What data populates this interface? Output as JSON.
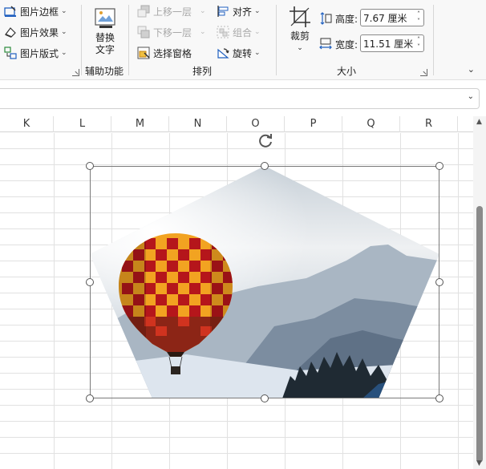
{
  "ribbon": {
    "picture_styles": {
      "border_label": "图片边框",
      "effects_label": "图片效果",
      "layout_label": "图片版式"
    },
    "accessibility": {
      "alt_text_label": "替换\n文字",
      "group_label": "辅助功能"
    },
    "arrange": {
      "bring_forward_label": "上移一层",
      "send_backward_label": "下移一层",
      "selection_pane_label": "选择窗格",
      "align_label": "对齐",
      "group_label_btn": "组合",
      "rotate_label": "旋转",
      "group_label": "排列"
    },
    "size": {
      "crop_label": "裁剪",
      "height_label": "高度:",
      "height_value": "7.67 厘米",
      "width_label": "宽度:",
      "width_value": "11.51 厘米",
      "group_label": "大小"
    }
  },
  "formula_bar": {
    "value": ""
  },
  "columns": [
    "K",
    "L",
    "M",
    "N",
    "O",
    "P",
    "Q",
    "R"
  ],
  "picture": {
    "description_icon": "hot-air-balloon-photo",
    "shape": "pentagon"
  },
  "colors": {
    "ribbon_bg": "#f8f8f8",
    "selection_border": "#555555",
    "balloon_red": "#b5161b",
    "balloon_yellow": "#f2a321"
  }
}
